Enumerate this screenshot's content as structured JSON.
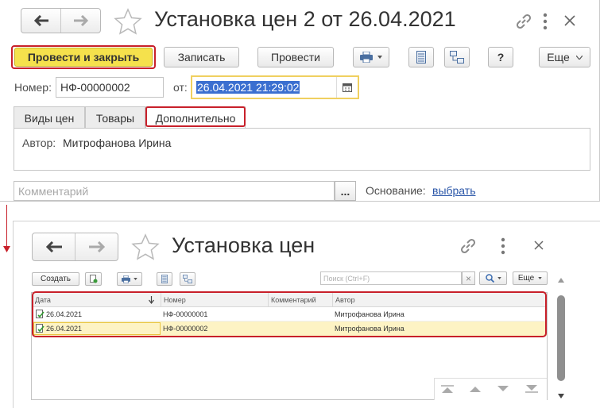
{
  "top_window": {
    "title": "Установка цен 2 от 26.04.2021",
    "toolbar": {
      "post_close": "Провести и закрыть",
      "save": "Записать",
      "post": "Провести",
      "help": "?",
      "more": "Еще"
    },
    "number_label": "Номер:",
    "number_value": "НФ-00000002",
    "date_label": "от:",
    "date_value": "26.04.2021 21:29:02",
    "tabs": [
      "Виды цен",
      "Товары",
      "Дополнительно"
    ],
    "author_label": "Автор:",
    "author_value": "Митрофанова Ирина",
    "comment_placeholder": "Комментарий",
    "basis_label": "Основание:",
    "basis_link": "выбрать",
    "ellipsis": "..."
  },
  "bottom_window": {
    "title": "Установка цен",
    "toolbar": {
      "create": "Создать",
      "search_placeholder": "Поиск (Ctrl+F)",
      "clear": "×",
      "more": "Еще"
    },
    "columns": [
      "Дата",
      "Номер",
      "Комментарий",
      "Автор"
    ],
    "rows": [
      {
        "date": "26.04.2021",
        "number": "НФ-00000001",
        "comment": "",
        "author": "Митрофанова Ирина"
      },
      {
        "date": "26.04.2021",
        "number": "НФ-00000002",
        "comment": "",
        "author": "Митрофанова Ирина"
      }
    ]
  },
  "colors": {
    "accent_yellow": "#f5e14c",
    "highlight_frame": "#c8202a",
    "selected_row": "#fdf3c4",
    "date_selection": "#3b6fd0",
    "link": "#2a56a8"
  }
}
